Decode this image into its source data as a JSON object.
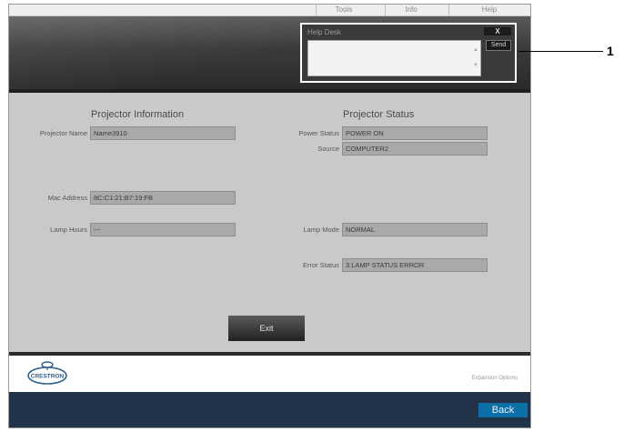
{
  "menu": {
    "tools": "Tools",
    "info": "Info",
    "help": "Help"
  },
  "help_desk": {
    "title": "Help Desk",
    "close_label": "X",
    "send_label": "Send",
    "message_value": ""
  },
  "callout": {
    "number": "1"
  },
  "projector_info": {
    "heading": "Projector Information",
    "fields": [
      {
        "label": "Projector Name",
        "value": "Name3910"
      },
      {
        "label": "Mac Address",
        "value": "8C:C1:21:B7:19:FB"
      },
      {
        "label": "Lamp Hours",
        "value": "---"
      }
    ]
  },
  "projector_status": {
    "heading": "Projector Status",
    "fields": [
      {
        "label": "Power Status",
        "value": "POWER ON"
      },
      {
        "label": "Source",
        "value": "COMPUTER2"
      },
      {
        "label": "Lamp Mode",
        "value": "NORMAL"
      },
      {
        "label": "Error Status",
        "value": "3.LAMP STATUS ERROR"
      }
    ]
  },
  "actions": {
    "exit_label": "Exit",
    "back_label": "Back"
  },
  "footer": {
    "brand": "CRESTRON",
    "expansion_options": "Expansion Options"
  },
  "colors": {
    "header_dark": "#2b2b2b",
    "content_bg": "#c9c9c9",
    "field_bg": "#a9a9a9",
    "bottom_bar": "#223248",
    "back_button": "#0b6fa8"
  }
}
